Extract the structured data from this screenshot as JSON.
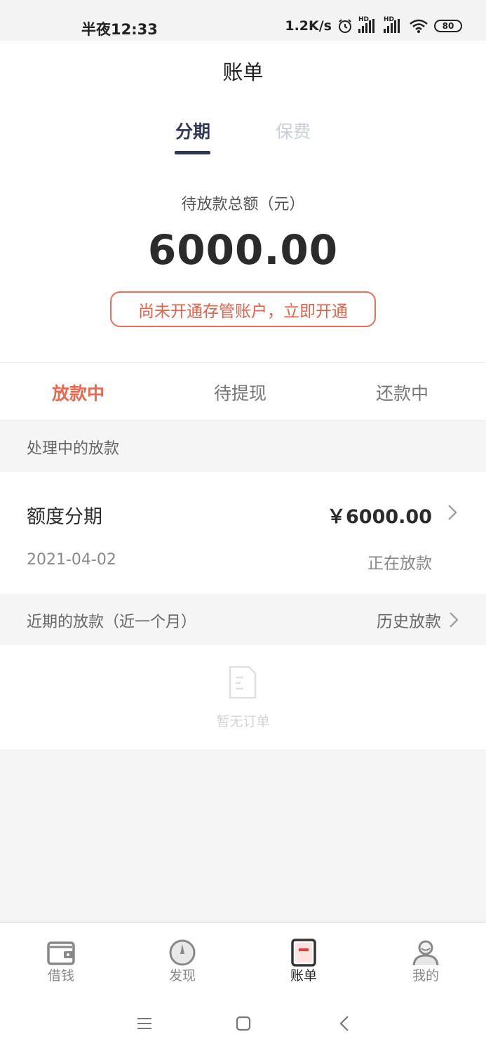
{
  "status_bar": {
    "time": "半夜12:33",
    "network_speed": "1.2K/s",
    "signal1_label": "HD",
    "signal2_label": "HD",
    "battery": "80",
    "icons": [
      "alarm-icon",
      "signal-icon",
      "signal-icon",
      "wifi-icon",
      "battery-icon"
    ]
  },
  "header": {
    "title": "账单"
  },
  "segments": [
    {
      "label": "分期",
      "active": true
    },
    {
      "label": "保费",
      "active": false
    }
  ],
  "summary": {
    "label": "待放款总额（元）",
    "amount": "6000.00",
    "notice": "尚未开通存管账户，立即开通"
  },
  "subtabs": [
    {
      "label": "放款中",
      "active": true
    },
    {
      "label": "待提现",
      "active": false
    },
    {
      "label": "还款中",
      "active": false
    }
  ],
  "processing": {
    "section_title": "处理中的放款",
    "items": [
      {
        "name": "额度分期",
        "amount": "￥6000.00",
        "date": "2021-04-02",
        "status": "正在放款"
      }
    ]
  },
  "recent": {
    "section_title": "近期的放款（近一个月）",
    "history_link": "历史放款",
    "empty_text": "暂无订单"
  },
  "bottom_nav": [
    {
      "label": "借钱",
      "icon": "wallet-icon",
      "active": false
    },
    {
      "label": "发现",
      "icon": "compass-icon",
      "active": false
    },
    {
      "label": "账单",
      "icon": "bill-icon",
      "active": true
    },
    {
      "label": "我的",
      "icon": "user-icon",
      "active": false
    }
  ],
  "colors": {
    "accent": "#e8694f",
    "segment_active": "#333a55",
    "segment_inactive": "#c9ced8",
    "page_bg": "#f5f5f6"
  }
}
